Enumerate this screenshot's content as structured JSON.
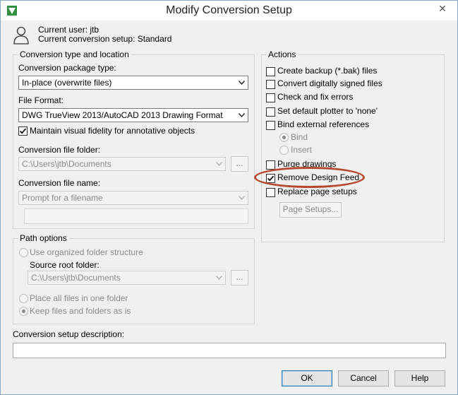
{
  "window": {
    "title": "Modify Conversion Setup",
    "close_glyph": "✕"
  },
  "user_info": {
    "current_user": "Current user: jtb",
    "current_setup": "Current conversion setup: Standard"
  },
  "conversion": {
    "legend": "Conversion type and location",
    "package_label": "Conversion package type:",
    "package_value": "In-place (overwrite files)",
    "format_label": "File Format:",
    "format_value": "DWG TrueView 2013/AutoCAD 2013 Drawing Format",
    "maintain_fidelity": {
      "label": "Maintain visual fidelity for annotative objects",
      "checked": true
    },
    "folder_label": "Conversion file folder:",
    "folder_value": "C:\\Users\\jtb\\Documents",
    "browse_label": "...",
    "name_label": "Conversion file name:",
    "name_value": "Prompt for a filename"
  },
  "path_options": {
    "legend": "Path options",
    "use_organized": "Use organized folder structure",
    "source_root_label": "Source root folder:",
    "source_root_value": "C:\\Users\\jtb\\Documents",
    "browse_label": "...",
    "place_all": "Place all files in one folder",
    "keep_files": "Keep files and folders as is"
  },
  "actions": {
    "legend": "Actions",
    "items": [
      {
        "label": "Create backup (*.bak) files",
        "checked": false
      },
      {
        "label": "Convert digitally signed files",
        "checked": false
      },
      {
        "label": "Check and fix errors",
        "checked": false
      },
      {
        "label": "Set default plotter to 'none'",
        "checked": false
      },
      {
        "label": "Bind external references",
        "checked": false
      }
    ],
    "bind_radio": "Bind",
    "insert_radio": "Insert",
    "purge": {
      "label": "Purge drawings",
      "checked": false
    },
    "remove_design_feed": {
      "label": "Remove Design Feed",
      "checked": true
    },
    "replace_page_setups": {
      "label": "Replace page setups",
      "checked": false
    },
    "page_setups_button": "Page Setups..."
  },
  "description": {
    "label": "Conversion setup description:",
    "value": ""
  },
  "buttons": {
    "ok": "OK",
    "cancel": "Cancel",
    "help": "Help"
  },
  "colors": {
    "highlight_ring": "#b5482f",
    "window_bg": "#f0f0f0"
  }
}
